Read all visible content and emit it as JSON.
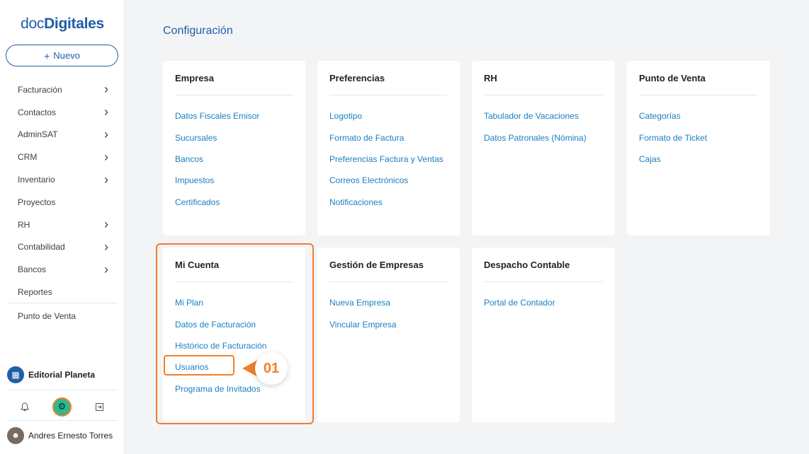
{
  "brand": {
    "prefix": "doc",
    "name": "Digitales"
  },
  "sidebar": {
    "new_label": "Nuevo",
    "items": [
      {
        "label": "Facturación",
        "has_children": true
      },
      {
        "label": "Contactos",
        "has_children": true
      },
      {
        "label": "AdminSAT",
        "has_children": true
      },
      {
        "label": "CRM",
        "has_children": true
      },
      {
        "label": "Inventario",
        "has_children": true
      },
      {
        "label": "Proyectos",
        "has_children": false
      },
      {
        "label": "RH",
        "has_children": true
      },
      {
        "label": "Contabilidad",
        "has_children": true
      },
      {
        "label": "Bancos",
        "has_children": true
      },
      {
        "label": "Reportes",
        "has_children": false
      },
      {
        "label": "Punto de Venta",
        "has_children": false
      }
    ],
    "company_name": "Editorial Planeta",
    "user_name": "Andres Ernesto Torres",
    "icons": [
      "bell-icon",
      "gear-icon",
      "logout-icon"
    ]
  },
  "main": {
    "title": "Configuración",
    "cards": [
      {
        "title": "Empresa",
        "links": [
          "Datos Fiscales Emisor",
          "Sucursales",
          "Bancos",
          "Impuestos",
          "Certificados"
        ]
      },
      {
        "title": "Preferencias",
        "links": [
          "Logotipo",
          "Formato de Factura",
          "Preferencias Factura y Ventas",
          "Correos Electrónicos",
          "Notificaciones"
        ]
      },
      {
        "title": "RH",
        "links": [
          "Tabulador de Vacaciones",
          "Datos Patronales (Nómina)"
        ]
      },
      {
        "title": "Punto de Venta",
        "links": [
          "Categorías",
          "Formato de Ticket",
          "Cajas"
        ]
      },
      {
        "title": "Mi Cuenta",
        "links": [
          "Mi Plan",
          "Datos de Facturación",
          "Histórico de Facturación",
          "Usuarios",
          "Programa de Invitados"
        ]
      },
      {
        "title": "Gestión de Empresas",
        "links": [
          "Nueva Empresa",
          "Vincular Empresa"
        ]
      },
      {
        "title": "Despacho Contable",
        "links": [
          "Portal de Contador"
        ]
      }
    ]
  },
  "annotation": {
    "step": "01",
    "accent": "#f07f2c"
  },
  "colors": {
    "brand": "#1f5ea8",
    "link": "#1a7fc1",
    "accent": "#f07f2c",
    "background": "#f3f4f6"
  }
}
